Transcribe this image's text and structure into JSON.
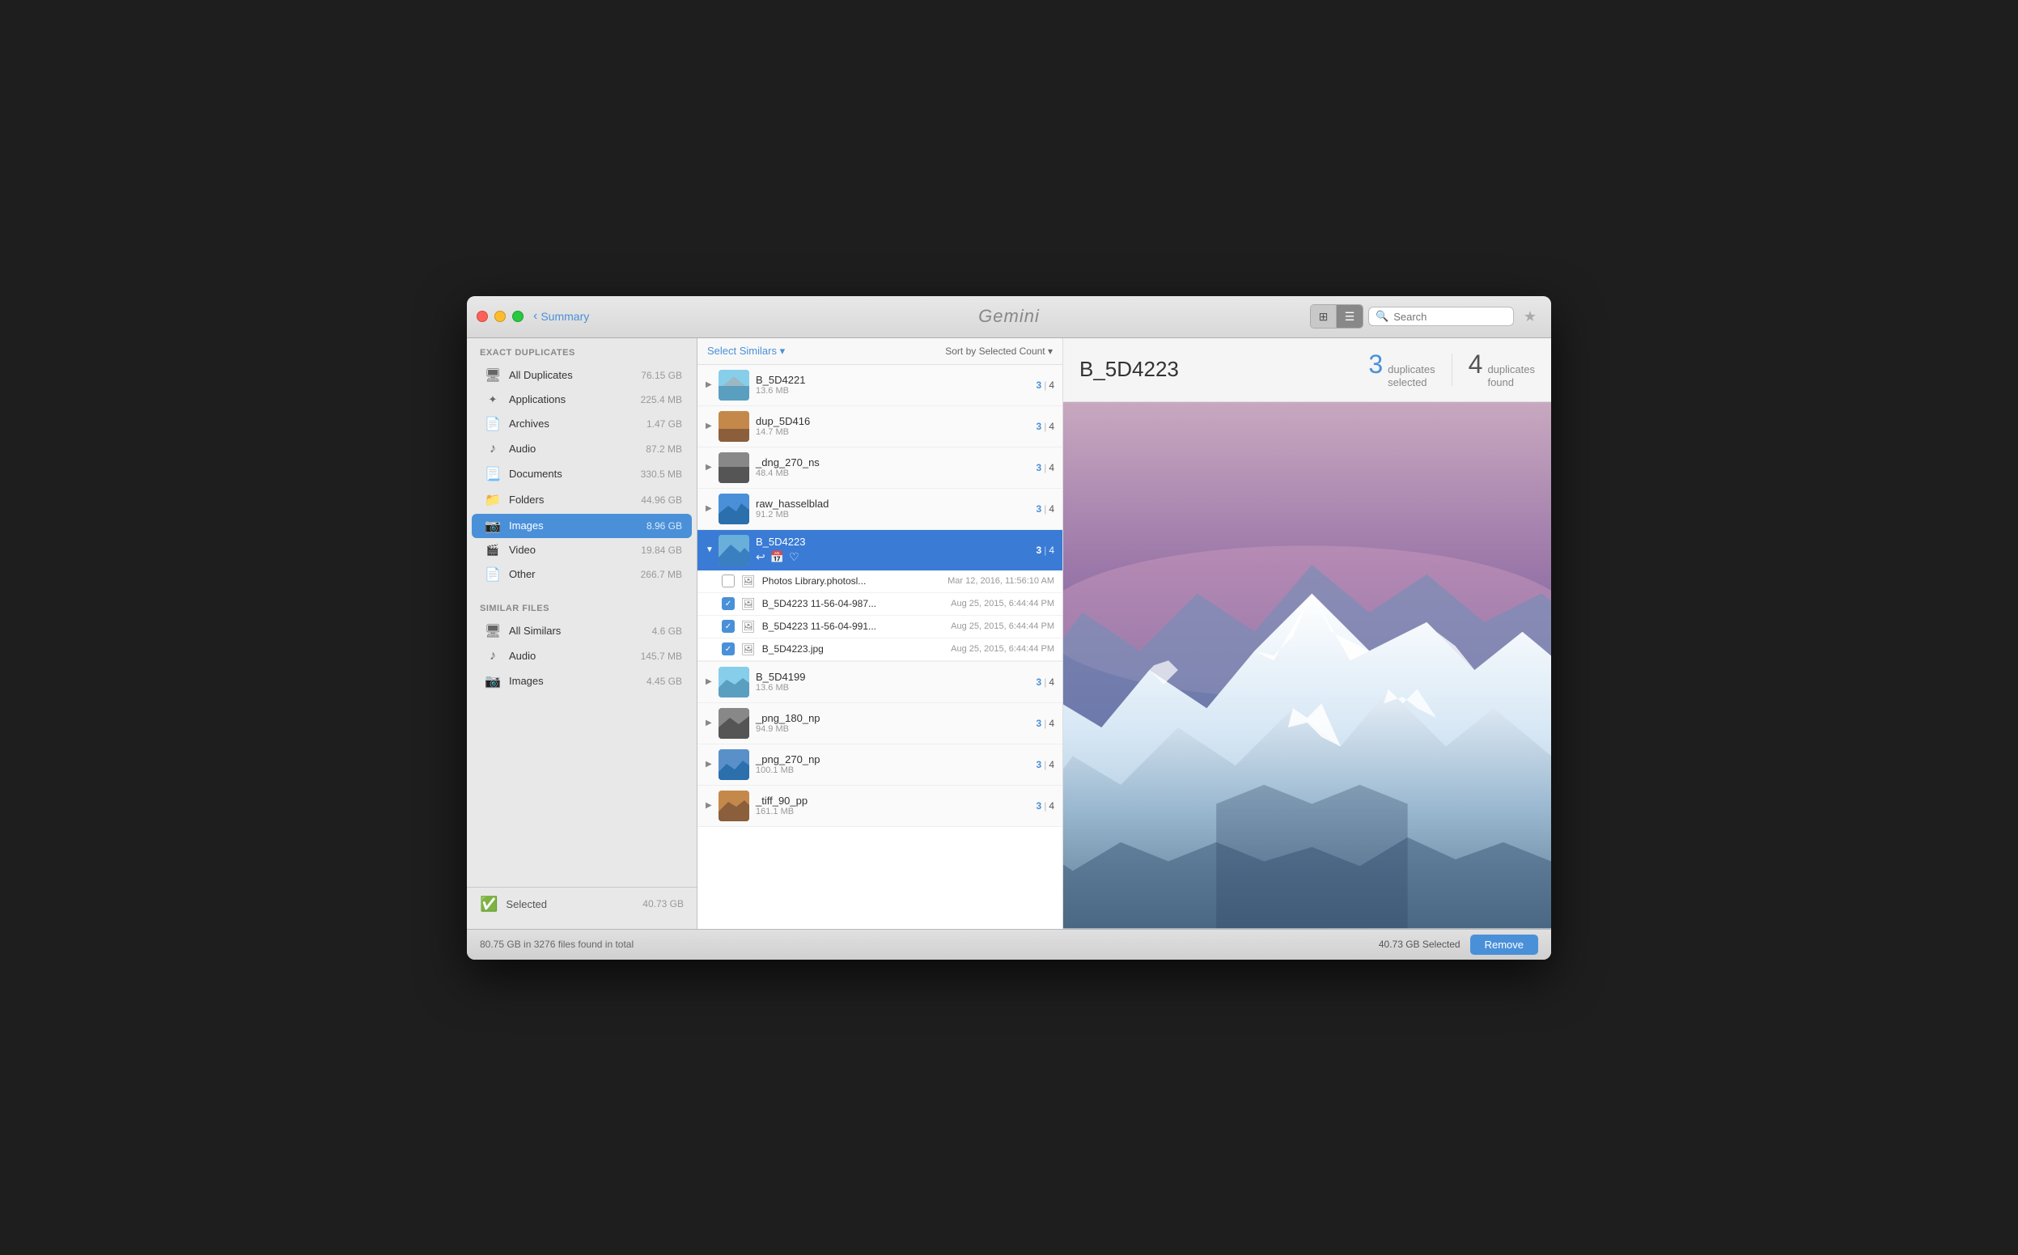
{
  "window": {
    "title": "Gemini"
  },
  "titlebar": {
    "back_label": "Summary",
    "app_name": "Gemini",
    "search_placeholder": "Search",
    "view_grid_icon": "⊞",
    "view_list_icon": "☰",
    "star_icon": "★"
  },
  "sidebar": {
    "exact_duplicates_header": "Exact Duplicates",
    "items": [
      {
        "id": "all-duplicates",
        "label": "All Duplicates",
        "size": "76.15 GB",
        "icon": "🖥",
        "active": false
      },
      {
        "id": "applications",
        "label": "Applications",
        "size": "225.4 MB",
        "icon": "✦",
        "active": false
      },
      {
        "id": "archives",
        "label": "Archives",
        "size": "1.47 GB",
        "icon": "📄",
        "active": false
      },
      {
        "id": "audio",
        "label": "Audio",
        "size": "87.2 MB",
        "icon": "♪",
        "active": false
      },
      {
        "id": "documents",
        "label": "Documents",
        "size": "330.5 MB",
        "icon": "📃",
        "active": false
      },
      {
        "id": "folders",
        "label": "Folders",
        "size": "44.96 GB",
        "icon": "📁",
        "active": false
      },
      {
        "id": "images",
        "label": "Images",
        "size": "8.96 GB",
        "icon": "📷",
        "active": true
      },
      {
        "id": "video",
        "label": "Video",
        "size": "19.84 GB",
        "icon": "🎬",
        "active": false
      },
      {
        "id": "other",
        "label": "Other",
        "size": "266.7 MB",
        "icon": "📄",
        "active": false
      }
    ],
    "similar_files_header": "Similar Files",
    "similar_items": [
      {
        "id": "all-similars",
        "label": "All Similars",
        "size": "4.6 GB",
        "icon": "🖥"
      },
      {
        "id": "sim-audio",
        "label": "Audio",
        "size": "145.7 MB",
        "icon": "♪"
      },
      {
        "id": "sim-images",
        "label": "Images",
        "size": "4.45 GB",
        "icon": "📷"
      }
    ],
    "selected_label": "Selected",
    "selected_size": "40.73 GB",
    "selected_icon": "✓"
  },
  "file_list": {
    "select_similars_label": "Select Similars ▾",
    "sort_label": "Sort by Selected Count ▾",
    "groups": [
      {
        "id": "B_5D4221",
        "name": "B_5D4221",
        "size": "13.6 MB",
        "selected": 3,
        "total": 4,
        "expanded": false,
        "thumb_color": "thumb-sky"
      },
      {
        "id": "dup_5D416",
        "name": "dup_5D416",
        "size": "14.7 MB",
        "selected": 3,
        "total": 4,
        "expanded": false,
        "thumb_color": "thumb-warm"
      },
      {
        "id": "_dng_270_ns",
        "name": "_dng_270_ns",
        "size": "48.4 MB",
        "selected": 3,
        "total": 4,
        "expanded": false,
        "thumb_color": "thumb-gray"
      },
      {
        "id": "raw_hasselblad",
        "name": "raw_hasselblad",
        "size": "91.2 MB",
        "selected": 3,
        "total": 4,
        "expanded": false,
        "thumb_color": "thumb-blue"
      },
      {
        "id": "B_5D4223",
        "name": "B_5D4223",
        "size": "",
        "selected": 3,
        "total": 4,
        "expanded": true,
        "thumb_color": "thumb-sky",
        "subitems": [
          {
            "id": "photos-lib",
            "name": "Photos Library.photosl...",
            "date": "Mar 12, 2016, 11:56:10 AM",
            "checked": false,
            "type_icon": "🖼"
          },
          {
            "id": "b5d4223-987",
            "name": "B_5D4223 11-56-04-987...",
            "date": "Aug 25, 2015, 6:44:44 PM",
            "checked": true,
            "type_icon": "🖼"
          },
          {
            "id": "b5d4223-991",
            "name": "B_5D4223 11-56-04-991...",
            "date": "Aug 25, 2015, 6:44:44 PM",
            "checked": true,
            "type_icon": "🖼"
          },
          {
            "id": "b5d4223-jpg",
            "name": "B_5D4223.jpg",
            "date": "Aug 25, 2015, 6:44:44 PM",
            "checked": true,
            "type_icon": "🖼"
          }
        ]
      },
      {
        "id": "B_5D4199",
        "name": "B_5D4199",
        "size": "13.6 MB",
        "selected": 3,
        "total": 4,
        "expanded": false,
        "thumb_color": "thumb-sky"
      },
      {
        "id": "_png_180_np",
        "name": "_png_180_np",
        "size": "94.9 MB",
        "selected": 3,
        "total": 4,
        "expanded": false,
        "thumb_color": "thumb-gray"
      },
      {
        "id": "_png_270_np",
        "name": "_png_270_np",
        "size": "100.1 MB",
        "selected": 3,
        "total": 4,
        "expanded": false,
        "thumb_color": "thumb-blue"
      },
      {
        "id": "_tiff_90_pp",
        "name": "_tiff_90_pp",
        "size": "161.1 MB",
        "selected": 3,
        "total": 4,
        "expanded": false,
        "thumb_color": "thumb-warm"
      }
    ]
  },
  "preview": {
    "title": "B_5D4223",
    "duplicates_selected": 3,
    "duplicates_selected_label": "duplicates\nselected",
    "duplicates_found": 4,
    "duplicates_found_label": "duplicates\nfound"
  },
  "statusbar": {
    "summary": "80.75 GB in 3276 files found in total",
    "selected_text": "40.73 GB Selected",
    "remove_label": "Remove"
  }
}
